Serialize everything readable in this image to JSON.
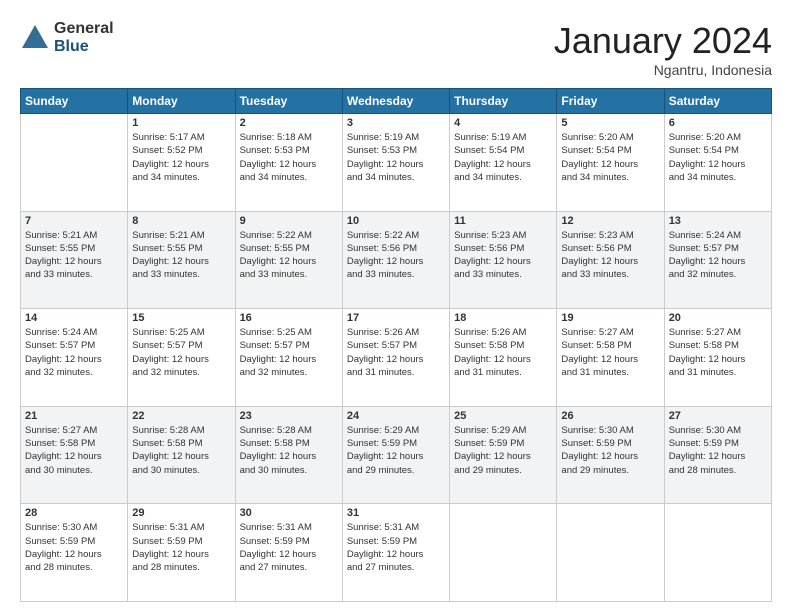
{
  "logo": {
    "general": "General",
    "blue": "Blue"
  },
  "header": {
    "month": "January 2024",
    "location": "Ngantru, Indonesia"
  },
  "weekdays": [
    "Sunday",
    "Monday",
    "Tuesday",
    "Wednesday",
    "Thursday",
    "Friday",
    "Saturday"
  ],
  "weeks": [
    [
      {
        "day": "",
        "info": ""
      },
      {
        "day": "1",
        "info": "Sunrise: 5:17 AM\nSunset: 5:52 PM\nDaylight: 12 hours\nand 34 minutes."
      },
      {
        "day": "2",
        "info": "Sunrise: 5:18 AM\nSunset: 5:53 PM\nDaylight: 12 hours\nand 34 minutes."
      },
      {
        "day": "3",
        "info": "Sunrise: 5:19 AM\nSunset: 5:53 PM\nDaylight: 12 hours\nand 34 minutes."
      },
      {
        "day": "4",
        "info": "Sunrise: 5:19 AM\nSunset: 5:54 PM\nDaylight: 12 hours\nand 34 minutes."
      },
      {
        "day": "5",
        "info": "Sunrise: 5:20 AM\nSunset: 5:54 PM\nDaylight: 12 hours\nand 34 minutes."
      },
      {
        "day": "6",
        "info": "Sunrise: 5:20 AM\nSunset: 5:54 PM\nDaylight: 12 hours\nand 34 minutes."
      }
    ],
    [
      {
        "day": "7",
        "info": "Sunrise: 5:21 AM\nSunset: 5:55 PM\nDaylight: 12 hours\nand 33 minutes."
      },
      {
        "day": "8",
        "info": "Sunrise: 5:21 AM\nSunset: 5:55 PM\nDaylight: 12 hours\nand 33 minutes."
      },
      {
        "day": "9",
        "info": "Sunrise: 5:22 AM\nSunset: 5:55 PM\nDaylight: 12 hours\nand 33 minutes."
      },
      {
        "day": "10",
        "info": "Sunrise: 5:22 AM\nSunset: 5:56 PM\nDaylight: 12 hours\nand 33 minutes."
      },
      {
        "day": "11",
        "info": "Sunrise: 5:23 AM\nSunset: 5:56 PM\nDaylight: 12 hours\nand 33 minutes."
      },
      {
        "day": "12",
        "info": "Sunrise: 5:23 AM\nSunset: 5:56 PM\nDaylight: 12 hours\nand 33 minutes."
      },
      {
        "day": "13",
        "info": "Sunrise: 5:24 AM\nSunset: 5:57 PM\nDaylight: 12 hours\nand 32 minutes."
      }
    ],
    [
      {
        "day": "14",
        "info": "Sunrise: 5:24 AM\nSunset: 5:57 PM\nDaylight: 12 hours\nand 32 minutes."
      },
      {
        "day": "15",
        "info": "Sunrise: 5:25 AM\nSunset: 5:57 PM\nDaylight: 12 hours\nand 32 minutes."
      },
      {
        "day": "16",
        "info": "Sunrise: 5:25 AM\nSunset: 5:57 PM\nDaylight: 12 hours\nand 32 minutes."
      },
      {
        "day": "17",
        "info": "Sunrise: 5:26 AM\nSunset: 5:57 PM\nDaylight: 12 hours\nand 31 minutes."
      },
      {
        "day": "18",
        "info": "Sunrise: 5:26 AM\nSunset: 5:58 PM\nDaylight: 12 hours\nand 31 minutes."
      },
      {
        "day": "19",
        "info": "Sunrise: 5:27 AM\nSunset: 5:58 PM\nDaylight: 12 hours\nand 31 minutes."
      },
      {
        "day": "20",
        "info": "Sunrise: 5:27 AM\nSunset: 5:58 PM\nDaylight: 12 hours\nand 31 minutes."
      }
    ],
    [
      {
        "day": "21",
        "info": "Sunrise: 5:27 AM\nSunset: 5:58 PM\nDaylight: 12 hours\nand 30 minutes."
      },
      {
        "day": "22",
        "info": "Sunrise: 5:28 AM\nSunset: 5:58 PM\nDaylight: 12 hours\nand 30 minutes."
      },
      {
        "day": "23",
        "info": "Sunrise: 5:28 AM\nSunset: 5:58 PM\nDaylight: 12 hours\nand 30 minutes."
      },
      {
        "day": "24",
        "info": "Sunrise: 5:29 AM\nSunset: 5:59 PM\nDaylight: 12 hours\nand 29 minutes."
      },
      {
        "day": "25",
        "info": "Sunrise: 5:29 AM\nSunset: 5:59 PM\nDaylight: 12 hours\nand 29 minutes."
      },
      {
        "day": "26",
        "info": "Sunrise: 5:30 AM\nSunset: 5:59 PM\nDaylight: 12 hours\nand 29 minutes."
      },
      {
        "day": "27",
        "info": "Sunrise: 5:30 AM\nSunset: 5:59 PM\nDaylight: 12 hours\nand 28 minutes."
      }
    ],
    [
      {
        "day": "28",
        "info": "Sunrise: 5:30 AM\nSunset: 5:59 PM\nDaylight: 12 hours\nand 28 minutes."
      },
      {
        "day": "29",
        "info": "Sunrise: 5:31 AM\nSunset: 5:59 PM\nDaylight: 12 hours\nand 28 minutes."
      },
      {
        "day": "30",
        "info": "Sunrise: 5:31 AM\nSunset: 5:59 PM\nDaylight: 12 hours\nand 27 minutes."
      },
      {
        "day": "31",
        "info": "Sunrise: 5:31 AM\nSunset: 5:59 PM\nDaylight: 12 hours\nand 27 minutes."
      },
      {
        "day": "",
        "info": ""
      },
      {
        "day": "",
        "info": ""
      },
      {
        "day": "",
        "info": ""
      }
    ]
  ]
}
